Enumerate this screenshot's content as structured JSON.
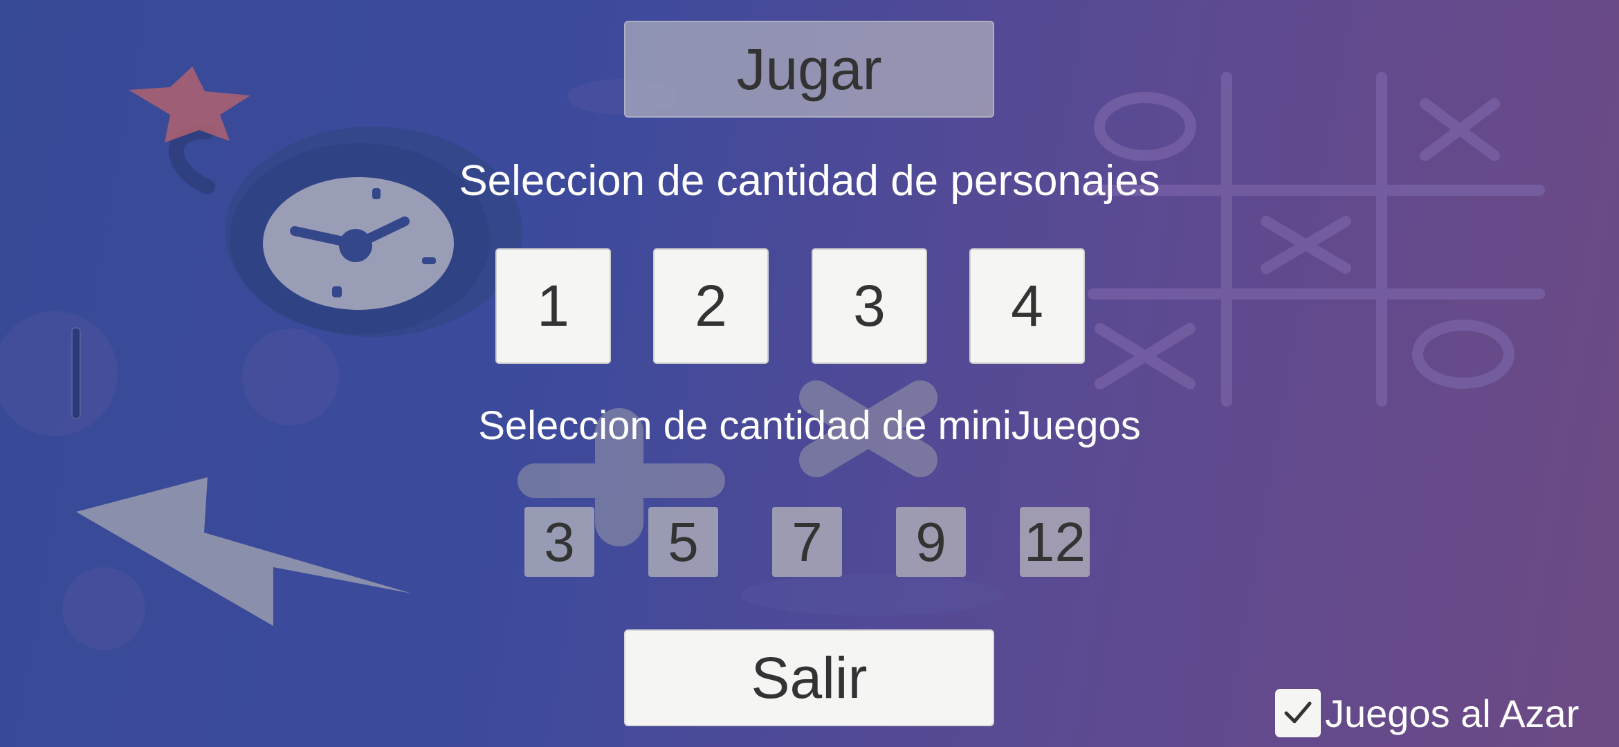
{
  "menu": {
    "play_label": "Jugar",
    "quit_label": "Salir",
    "characters_heading": "Seleccion de cantidad de personajes",
    "minigames_heading": "Seleccion de cantidad de miniJuegos",
    "character_options": [
      "1",
      "2",
      "3",
      "4"
    ],
    "minigame_options": [
      "3",
      "5",
      "7",
      "9",
      "12"
    ],
    "random_games": {
      "label": "Juegos al Azar",
      "checked": true
    }
  },
  "colors": {
    "background_start": "#374a96",
    "background_end": "#6d4a84",
    "button_light": "#f5f5f3",
    "button_text": "#333333",
    "heading_text": "#ffffff"
  },
  "icons": [
    "bomb-icon",
    "clock-icon",
    "lightning-icon",
    "tic-tac-toe-icon",
    "check-icon"
  ]
}
